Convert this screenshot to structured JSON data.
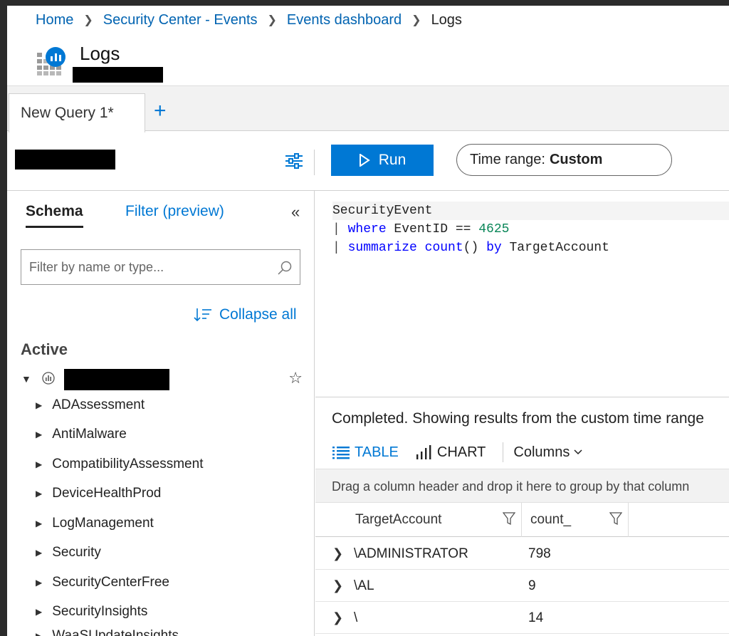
{
  "breadcrumb": {
    "items": [
      "Home",
      "Security Center - Events",
      "Events dashboard"
    ],
    "current": "Logs"
  },
  "header": {
    "title": "Logs"
  },
  "tabs": {
    "active_label": "New Query 1*",
    "add_label": "+"
  },
  "toolbar": {
    "run_label": "Run",
    "time_range_prefix": "Time range:",
    "time_range_value": "Custom"
  },
  "sidebar": {
    "schema_tab": "Schema",
    "filter_tab": "Filter (preview)",
    "collapse_icon": "«",
    "search_placeholder": "Filter by name or type...",
    "collapse_all": "Collapse all",
    "active_label": "Active",
    "items": [
      "ADAssessment",
      "AntiMalware",
      "CompatibilityAssessment",
      "DeviceHealthProd",
      "LogManagement",
      "Security",
      "SecurityCenterFree",
      "SecurityInsights",
      "WaaSUpdateInsights"
    ]
  },
  "editor": {
    "line1": "SecurityEvent",
    "line2_pipe": "| ",
    "line2_kw": "where",
    "line2_mid": " EventID == ",
    "line2_num": "4625",
    "line3_pipe": "| ",
    "line3_kw1": "summarize",
    "line3_sp": " ",
    "line3_kw2": "count",
    "line3_paren": "() ",
    "line3_kw3": "by",
    "line3_end": " TargetAccount"
  },
  "results": {
    "status": "Completed. Showing results from the custom time range",
    "table_tab": "TABLE",
    "chart_tab": "CHART",
    "columns_label": "Columns",
    "group_hint": "Drag a column header and drop it here to group by that column",
    "columns": [
      "TargetAccount",
      "count_"
    ],
    "rows": [
      {
        "account": "\\ADMINISTRATOR",
        "count": "798"
      },
      {
        "account": "\\AL",
        "count": "9"
      },
      {
        "account": "\\",
        "count": "14"
      }
    ]
  },
  "colors": {
    "accent": "#0078d4",
    "link": "#0063b1"
  }
}
